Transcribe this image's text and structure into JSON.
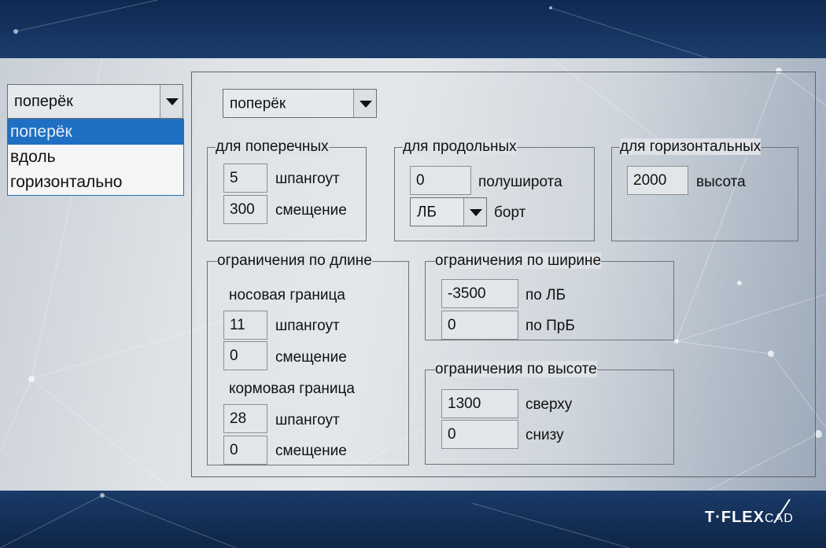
{
  "left_dropdown": {
    "value": "поперёк",
    "options": [
      "поперёк",
      "вдоль",
      "горизонтально"
    ],
    "selected_index": 0
  },
  "main_dropdown": {
    "value": "поперёк"
  },
  "transverse": {
    "title": "для поперечных",
    "rows": [
      {
        "value": "5",
        "label": "шпангоут"
      },
      {
        "value": "300",
        "label": "смещение"
      }
    ]
  },
  "longitudinal": {
    "title": "для продольных",
    "half_width_value": "0",
    "half_width_label": "полуширота",
    "side_value": "ЛБ",
    "side_label": "борт"
  },
  "horizontal": {
    "title": "для горизонтальных",
    "height_value": "2000",
    "height_label": "высота"
  },
  "length_limits": {
    "title": "ограничения по длине",
    "bow_title": "носовая граница",
    "bow_rows": [
      {
        "value": "11",
        "label": "шпангоут"
      },
      {
        "value": "0",
        "label": "смещение"
      }
    ],
    "stern_title": "кормовая граница",
    "stern_rows": [
      {
        "value": "28",
        "label": "шпангоут"
      },
      {
        "value": "0",
        "label": "смещение"
      }
    ]
  },
  "width_limits": {
    "title": "ограничения по ширине",
    "rows": [
      {
        "value": "-3500",
        "label": "по ЛБ"
      },
      {
        "value": "0",
        "label": "по ПрБ"
      }
    ]
  },
  "height_limits": {
    "title": "ограничения по высоте",
    "rows": [
      {
        "value": "1300",
        "label": "сверху"
      },
      {
        "value": "0",
        "label": "снизу"
      }
    ]
  },
  "logo": {
    "brand": "T·FLEX",
    "suffix": "CAD"
  },
  "colors": {
    "selection": "#1f6fc2",
    "band": "#14305a",
    "panel": "#dfe3e7"
  }
}
